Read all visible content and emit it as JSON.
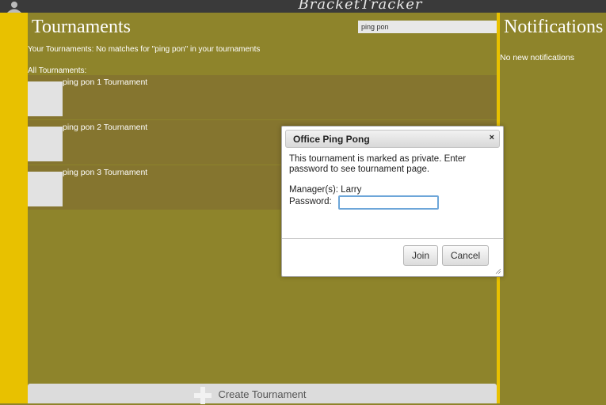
{
  "app": {
    "logo_text": "BracketTracker"
  },
  "main": {
    "title": "Tournaments",
    "search": {
      "value": "ping pon"
    },
    "your_tournaments_message": "Your Tournaments: No matches for \"ping pon\" in your tournaments",
    "all_tournaments_label": "All Tournaments:",
    "tournaments": [
      {
        "name": "ping pon 1 Tournament"
      },
      {
        "name": "ping pon 2 Tournament"
      },
      {
        "name": "ping pon 3 Tournament"
      }
    ],
    "create_label": "Create Tournament"
  },
  "sidebar": {
    "title": "Notifications",
    "empty_message": "No new notifications"
  },
  "dialog": {
    "title": "Office Ping Pong",
    "close_label": "×",
    "message": "This tournament is marked as private. Enter password to see tournament page.",
    "managers": "Manager(s): Larry",
    "password_label": "Password:",
    "password_value": "",
    "join_label": "Join",
    "cancel_label": "Cancel"
  },
  "colors": {
    "background": "#8e842b",
    "accent_yellow": "#e8c100",
    "row": "#85752f",
    "topbar": "#3a3a3a",
    "focus_ring": "#6da6d9"
  },
  "icons": {
    "user": "user-icon",
    "search": "search-icon",
    "plus": "plus-icon",
    "close": "close-icon",
    "resize": "resize-grip-icon"
  }
}
